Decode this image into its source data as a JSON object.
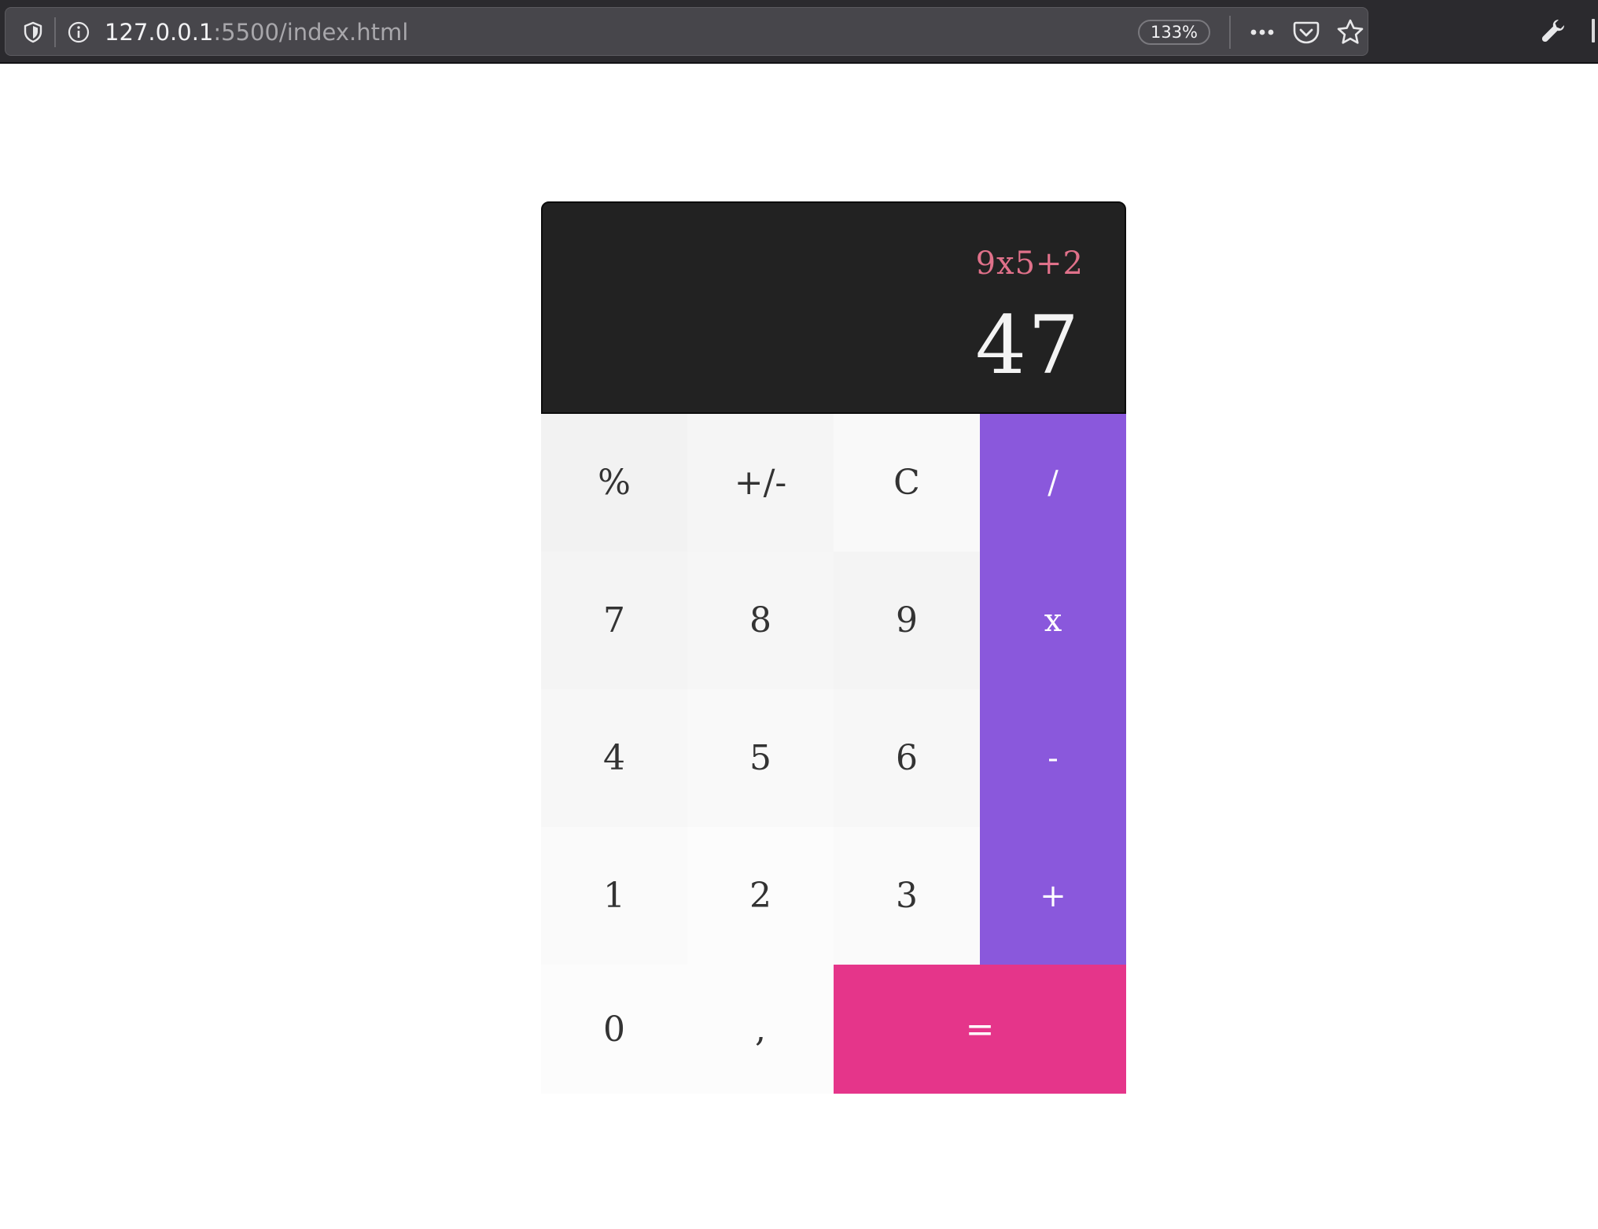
{
  "browser": {
    "url_host": "127.0.0.1",
    "url_rest": ":5500/index.html",
    "zoom": "133%",
    "icons": {
      "shield": "shield-icon",
      "info": "info-icon",
      "more": "more-icon",
      "pocket": "pocket-icon",
      "bookmark": "star-icon",
      "tools": "wrench-icon"
    }
  },
  "calculator": {
    "expression": "9x5+2",
    "result": "47",
    "colors": {
      "display_bg": "#222222",
      "expression": "#e0718a",
      "operator_bg": "#8a58dc",
      "equals_bg": "#e5358a"
    },
    "keys": {
      "percent": "%",
      "negate": "+/-",
      "clear": "C",
      "divide": "/",
      "seven": "7",
      "eight": "8",
      "nine": "9",
      "multiply": "x",
      "four": "4",
      "five": "5",
      "six": "6",
      "subtract": "-",
      "one": "1",
      "two": "2",
      "three": "3",
      "add": "+",
      "zero": "0",
      "decimal": ",",
      "equals": "="
    }
  }
}
